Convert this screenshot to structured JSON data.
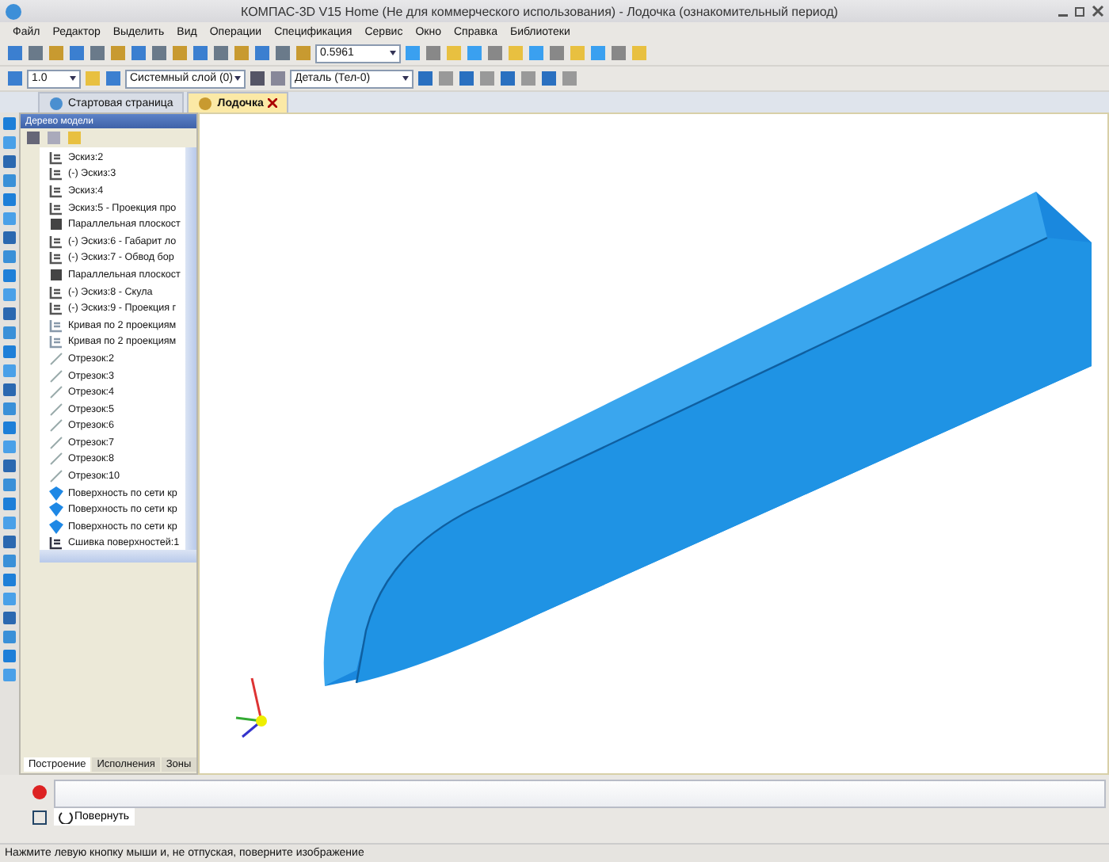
{
  "window": {
    "title": "КОМПАС-3D V15 Home (Не для коммерческого использования) - Лодочка (ознакомительный период)"
  },
  "menu": [
    "Файл",
    "Редактор",
    "Выделить",
    "Вид",
    "Операции",
    "Спецификация",
    "Сервис",
    "Окно",
    "Справка",
    "Библиотеки"
  ],
  "toolbar": {
    "scale": "0.5961",
    "step": "1.0",
    "layer": "Системный слой (0)",
    "part": "Деталь (Тел-0)"
  },
  "doc_tabs": [
    {
      "label": "Стартовая страница",
      "selected": false,
      "closable": false
    },
    {
      "label": "Лодочка",
      "selected": true,
      "closable": true
    }
  ],
  "tree": {
    "title": "Дерево модели",
    "items": [
      {
        "kind": "sketch",
        "label": "Эскиз:2"
      },
      {
        "kind": "sketch",
        "label": "(-) Эскиз:3"
      },
      {
        "kind": "sketch",
        "label": "Эскиз:4"
      },
      {
        "kind": "sketch",
        "label": "Эскиз:5 - Проекция про"
      },
      {
        "kind": "plane",
        "label": "Параллельная плоскост"
      },
      {
        "kind": "sketch",
        "label": "(-) Эскиз:6 - Габарит ло"
      },
      {
        "kind": "sketch",
        "label": "(-) Эскиз:7 - Обвод бор"
      },
      {
        "kind": "plane",
        "label": "Параллельная плоскост"
      },
      {
        "kind": "sketch",
        "label": "(-) Эскиз:8 - Скула"
      },
      {
        "kind": "sketch",
        "label": "(-) Эскиз:9 - Проекция г"
      },
      {
        "kind": "curve",
        "label": "Кривая по 2 проекциям"
      },
      {
        "kind": "curve",
        "label": "Кривая по 2 проекциям"
      },
      {
        "kind": "segment",
        "label": "Отрезок:2"
      },
      {
        "kind": "segment",
        "label": "Отрезок:3"
      },
      {
        "kind": "segment",
        "label": "Отрезок:4"
      },
      {
        "kind": "segment",
        "label": "Отрезок:5"
      },
      {
        "kind": "segment",
        "label": "Отрезок:6"
      },
      {
        "kind": "segment",
        "label": "Отрезок:7"
      },
      {
        "kind": "segment",
        "label": "Отрезок:8"
      },
      {
        "kind": "segment",
        "label": "Отрезок:10"
      },
      {
        "kind": "surface",
        "label": "Поверхность по сети кр"
      },
      {
        "kind": "surface",
        "label": "Поверхность по сети кр"
      },
      {
        "kind": "surface",
        "label": "Поверхность по сети кр"
      },
      {
        "kind": "stitch",
        "label": "Сшивка поверхностей:1"
      }
    ],
    "tabs": [
      {
        "label": "Построение",
        "selected": true
      },
      {
        "label": "Исполнения",
        "selected": false
      },
      {
        "label": "Зоны",
        "selected": false
      }
    ]
  },
  "command": {
    "button": "Повернуть"
  },
  "status_bar": "Нажмите левую кнопку мыши и, не отпуская, поверните изображение"
}
